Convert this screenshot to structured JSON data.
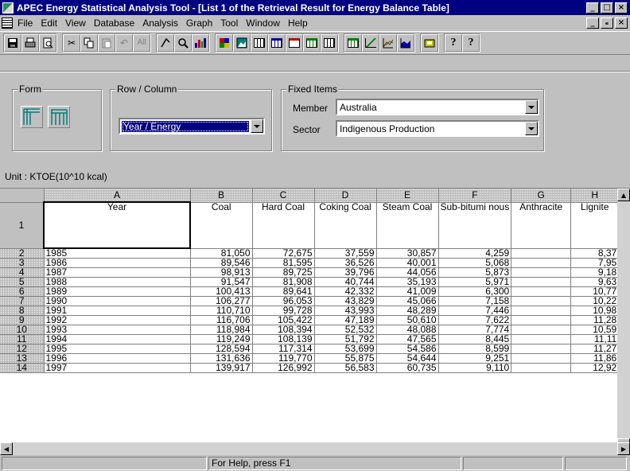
{
  "window": {
    "title": "APEC Energy Statistical Analysis Tool - [List 1 of the Retrieval Result for Energy Balance Table]",
    "buttons": [
      "_",
      "□",
      "×"
    ]
  },
  "menu": {
    "items": [
      "File",
      "Edit",
      "View",
      "Database",
      "Analysis",
      "Graph",
      "Tool",
      "Window",
      "Help"
    ],
    "mdi_buttons": [
      "_",
      "ₑ",
      "×"
    ]
  },
  "toolbar": {
    "all_label": "All",
    "help_label": "?",
    "context_help_label": "?"
  },
  "panel": {
    "form_label": "Form",
    "rowcol_label": "Row / Column",
    "rowcol_value": "Year / Energy",
    "fixed_label": "Fixed Items",
    "member_label": "Member",
    "member_value": "Australia",
    "sector_label": "Sector",
    "sector_value": "Indigenous Production"
  },
  "unit": "Unit :  KTOE(10^10 kcal)",
  "grid": {
    "col_letters": [
      "A",
      "B",
      "C",
      "D",
      "E",
      "F",
      "G",
      "H"
    ],
    "headers": [
      "Year",
      "Coal",
      "Hard Coal",
      "Coking Coal",
      "Steam Coal",
      "Sub-bitumi nous",
      "Anthracite",
      "Lignite"
    ],
    "header_row_num": "1",
    "rows": [
      {
        "num": "2",
        "cells": [
          "1985",
          "81,050",
          "72,675",
          "37,559",
          "30,857",
          "4,259",
          "",
          "8,37"
        ]
      },
      {
        "num": "3",
        "cells": [
          "1986",
          "89,546",
          "81,595",
          "36,526",
          "40,001",
          "5,068",
          "",
          "7,95"
        ]
      },
      {
        "num": "4",
        "cells": [
          "1987",
          "98,913",
          "89,725",
          "39,796",
          "44,056",
          "5,873",
          "",
          "9,18"
        ]
      },
      {
        "num": "5",
        "cells": [
          "1988",
          "91,547",
          "81,908",
          "40,744",
          "35,193",
          "5,971",
          "",
          "9,63"
        ]
      },
      {
        "num": "6",
        "cells": [
          "1989",
          "100,413",
          "89,641",
          "42,332",
          "41,009",
          "6,300",
          "",
          "10,77"
        ]
      },
      {
        "num": "7",
        "cells": [
          "1990",
          "106,277",
          "96,053",
          "43,829",
          "45,066",
          "7,158",
          "",
          "10,22"
        ]
      },
      {
        "num": "8",
        "cells": [
          "1991",
          "110,710",
          "99,728",
          "43,993",
          "48,289",
          "7,446",
          "",
          "10,98"
        ]
      },
      {
        "num": "9",
        "cells": [
          "1992",
          "116,706",
          "105,422",
          "47,189",
          "50,610",
          "7,622",
          "",
          "11,28"
        ]
      },
      {
        "num": "10",
        "cells": [
          "1993",
          "118,984",
          "108,394",
          "52,532",
          "48,088",
          "7,774",
          "",
          "10,59"
        ]
      },
      {
        "num": "11",
        "cells": [
          "1994",
          "119,249",
          "108,139",
          "51,792",
          "47,565",
          "8,445",
          "",
          "11,11"
        ]
      },
      {
        "num": "12",
        "cells": [
          "1995",
          "128,594",
          "117,314",
          "53,699",
          "54,586",
          "8,599",
          "",
          "11,27"
        ]
      },
      {
        "num": "13",
        "cells": [
          "1996",
          "131,636",
          "119,770",
          "55,875",
          "54,644",
          "9,251",
          "",
          "11,86"
        ]
      },
      {
        "num": "14",
        "cells": [
          "1997",
          "139,917",
          "126,992",
          "56,583",
          "60,735",
          "9,110",
          "",
          "12,92"
        ]
      }
    ]
  },
  "status": {
    "help_text": "For Help, press F1"
  }
}
